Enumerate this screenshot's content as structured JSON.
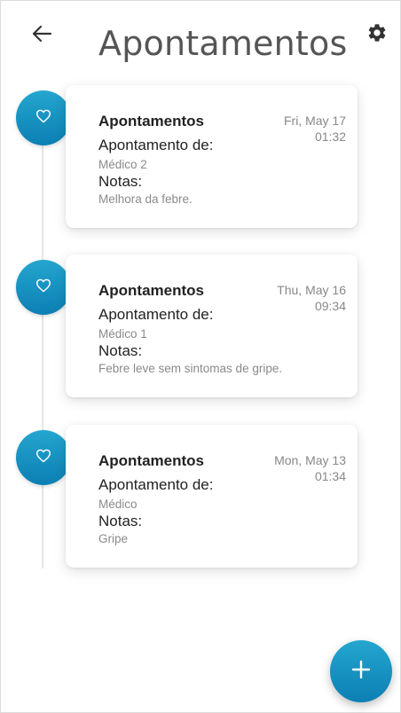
{
  "header": {
    "title": "Apontamentos",
    "back_icon": "arrow-left-icon",
    "settings_icon": "gear-icon"
  },
  "entries": [
    {
      "icon": "heart-icon",
      "title": "Apontamentos",
      "date": "Fri, May 17",
      "time": "01:32",
      "label_from": "Apontamento de:",
      "from": "Médico 2",
      "label_notes": "Notas:",
      "notes": "Melhora da febre."
    },
    {
      "icon": "heart-icon",
      "title": "Apontamentos",
      "date": "Thu, May 16",
      "time": "09:34",
      "label_from": "Apontamento de:",
      "from": "Médico 1",
      "label_notes": "Notas:",
      "notes": "Febre leve sem sintomas de gripe."
    },
    {
      "icon": "heart-icon",
      "title": "Apontamentos",
      "date": "Mon, May 13",
      "time": "01:34",
      "label_from": "Apontamento de:",
      "from": "Médico",
      "label_notes": "Notas:",
      "notes": "Gripe"
    }
  ],
  "fab": {
    "icon": "plus-icon"
  },
  "colors": {
    "accent": "#1495c4",
    "accent_dark": "#0c7fb3"
  }
}
